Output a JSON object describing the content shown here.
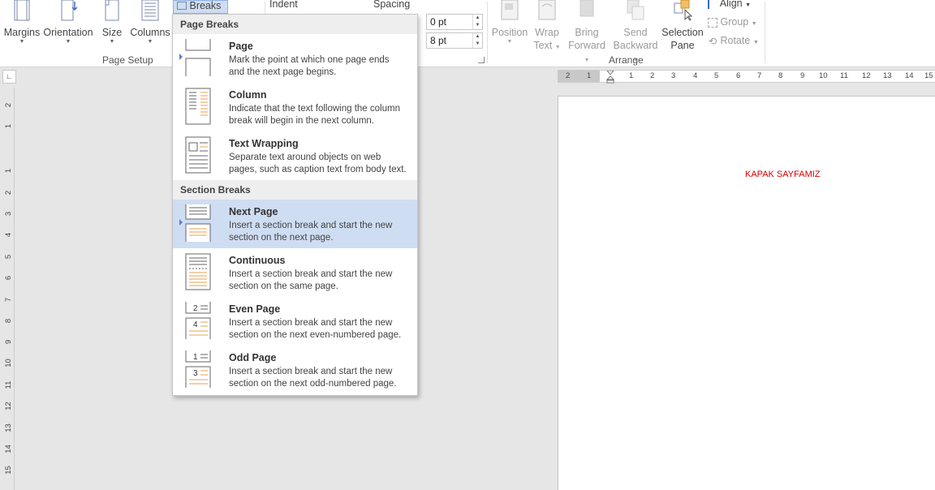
{
  "ribbon": {
    "page_setup": {
      "margins": "Margins",
      "orientation": "Orientation",
      "size": "Size",
      "columns": "Columns",
      "breaks": "Breaks",
      "group_label": "Page Setup"
    },
    "paragraph": {
      "indent_label": "Indent",
      "spacing_label": "Spacing",
      "spacing_before": "0 pt",
      "spacing_after": "8 pt"
    },
    "arrange": {
      "position": "Position",
      "wrap_line1": "Wrap",
      "wrap_line2": "Text",
      "bring_line1": "Bring",
      "bring_line2": "Forward",
      "send_line1": "Send",
      "send_line2": "Backward",
      "selection_line1": "Selection",
      "selection_line2": "Pane",
      "align": "Align",
      "group": "Group",
      "rotate": "Rotate",
      "group_label": "Arrange"
    }
  },
  "breaks_menu": {
    "page_breaks_header": "Page Breaks",
    "section_breaks_header": "Section Breaks",
    "items": [
      {
        "title": "Page",
        "desc1": "Mark the point at which one page ends",
        "desc2": "and the next page begins."
      },
      {
        "title": "Column",
        "desc1": "Indicate that the text following the column",
        "desc2": "break will begin in the next column."
      },
      {
        "title": "Text Wrapping",
        "desc1": "Separate text around objects on web",
        "desc2": "pages, such as caption text from body text."
      },
      {
        "title": "Next Page",
        "desc1": "Insert a section break and start the new",
        "desc2": "section on the next page."
      },
      {
        "title": "Continuous",
        "desc1": "Insert a section break and start the new",
        "desc2": "section on the same page."
      },
      {
        "title": "Even Page",
        "desc1": "Insert a section break and start the new",
        "desc2": "section on the next even-numbered page."
      },
      {
        "title": "Odd Page",
        "desc1": "Insert a section break and start the new",
        "desc2": "section on the next odd-numbered page."
      }
    ],
    "highlighted_item": "Next Page",
    "icon_numbers": {
      "even_top": "2",
      "even_bottom": "4",
      "odd_top": "1",
      "odd_bottom": "3"
    }
  },
  "hruler_labels": [
    "2",
    "1",
    "1",
    "2",
    "3",
    "4",
    "5",
    "6",
    "7",
    "8",
    "9",
    "10",
    "11",
    "12",
    "13",
    "14",
    "15"
  ],
  "vruler_labels": [
    "2",
    "1",
    "1",
    "2",
    "3",
    "4",
    "5",
    "6",
    "7",
    "8",
    "9",
    "10",
    "11",
    "12",
    "13",
    "14",
    "15"
  ],
  "document": {
    "text": "KAPAK SAYFAMIZ",
    "text_color": "#d40000"
  },
  "colors": {
    "highlight": "#cfddf2",
    "accent_orange": "#e8a050"
  }
}
